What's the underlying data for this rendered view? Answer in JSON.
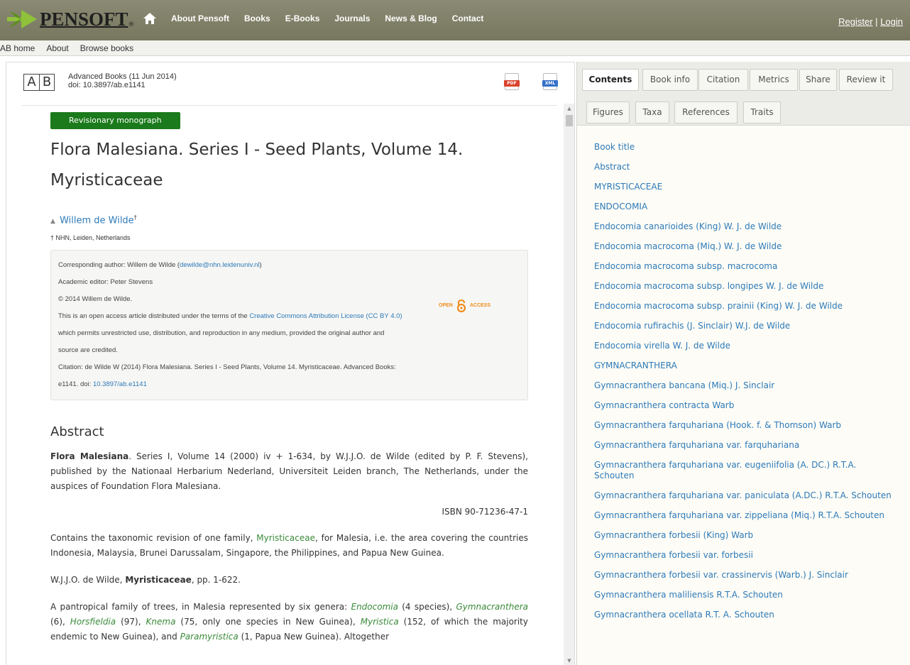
{
  "brand": {
    "name": "PENSOFT",
    "reg": "®"
  },
  "main_nav": [
    "About Pensoft",
    "Books",
    "E-Books",
    "Journals",
    "News & Blog",
    "Contact"
  ],
  "auth": {
    "register": "Register",
    "sep": "|",
    "login": "Login"
  },
  "sub_nav": [
    "AB home",
    "About",
    "Browse books"
  ],
  "doc": {
    "journal_line": "Advanced Books (11 Jun 2014)",
    "doi_line": "doi: 10.3897/ab.e1141",
    "ab_left": "A",
    "ab_right": "B",
    "pdf_label": "PDF",
    "xml_label": "XML",
    "badge": "Revisionary monograph",
    "title": "Flora Malesiana. Series I - Seed Plants, Volume 14. Myristicaceae",
    "author": "Willem de Wilde",
    "author_sup": "†",
    "affiliation": "† NHN, Leiden, Netherlands"
  },
  "info": {
    "corr_prefix": "Corresponding author: Willem de Wilde (",
    "corr_email": "dewilde@nhn.leidenuniv.nl",
    "corr_suffix": ")",
    "editor": "Academic editor: Peter Stevens",
    "copyright": "© 2014 Willem de Wilde.",
    "license_prefix": "This is an open access article distributed under the terms of the ",
    "license_link": "Creative Commons Attribution License (CC BY 4.0)",
    "license_line2": "which permits unrestricted use, distribution, and reproduction in any medium, provided the original author and",
    "license_line3": "source are credited.",
    "citation_line1": "Citation: de Wilde W (2014) Flora Malesiana. Series I - Seed Plants, Volume 14. Myristicaceae. Advanced Books:",
    "citation_prefix": "e1141. doi: ",
    "citation_doi": "10.3897/ab.e1141",
    "oa_open": "OPEN",
    "oa_access": "ACCESS"
  },
  "abstract": {
    "heading": "Abstract",
    "p1_bold": "Flora Malesiana",
    "p1_rest": ". Series I, Volume 14 (2000) iv + 1-634, by W.J.J.O. de Wilde (edited by P. F. Stevens), published by the Nationaal Herbarium Nederland, Universiteit Leiden branch, The Netherlands, under the auspices of Foundation Flora Malesiana.",
    "isbn": "ISBN 90-71236-47-1",
    "p2_a": "Contains the taxonomic revision of one family, ",
    "p2_link": "Myristicaceae",
    "p2_b": ", for Malesia, i.e. the area covering the countries Indonesia, Malaysia, Brunei Darussalam, Singapore, the Philippines, and Papua New Guinea.",
    "p3_a": "W.J.J.O. de Wilde, ",
    "p3_bold": "Myristicaceae",
    "p3_b": ", pp. 1-622.",
    "p4_a": "A pantropical family of trees, in Malesia represented by six genera: ",
    "p4_g1": "Endocomia",
    "p4_b": " (4 species), ",
    "p4_g2": "Gymnacranthera",
    "p4_c": " (6), ",
    "p4_g3": "Horsfieldia",
    "p4_d": " (97), ",
    "p4_g4": "Knema",
    "p4_e": " (75, only one species in New Guinea), ",
    "p4_g5": "Myristica",
    "p4_f": " (152, of which the majority endemic to New Guinea), and ",
    "p4_g6": "Paramyristica",
    "p4_g": " (1, Papua New Guinea). Altogether"
  },
  "tabs_row1": [
    "Contents",
    "Book info",
    "Citation",
    "Metrics",
    "Share",
    "Review it"
  ],
  "tabs_row2": [
    "Figures",
    "Taxa",
    "References",
    "Traits"
  ],
  "toc": [
    "Book title",
    "Abstract",
    "MYRISTICACEAE",
    "ENDOCOMIA",
    "Endocomia canarioides (King) W. J. de Wilde",
    "Endocomia macrocoma (Miq.) W. J. de Wilde",
    "Endocomia macrocoma subsp. macrocoma",
    "Endocomia macrocoma subsp. longipes W. J. de Wilde",
    "Endocomia macrocoma subsp. prainii (King) W. J. de Wilde",
    "Endocomia rufirachis (J. Sinclair) W.J. de Wilde",
    "Endocomia virella W. J. de Wilde",
    "GYMNACRANTHERA",
    "Gymnacranthera bancana (Miq.) J. Sinclair",
    "Gymnacranthera contracta Warb",
    "Gymnacranthera farquhariana (Hook. f. & Thomson) Warb",
    "Gymnacranthera farquhariana var. farquhariana",
    "Gymnacranthera farquhariana var. eugeniifolia (A. DC.) R.T.A. Schouten",
    "Gymnacranthera farquhariana var. paniculata (A.DC.) R.T.A. Schouten",
    "Gymnacranthera farquhariana var. zippeliana (Miq.) R.T.A. Schouten",
    "Gymnacranthera forbesii (King) Warb",
    "Gymnacranthera forbesii var. forbesii",
    "Gymnacranthera forbesii var. crassinervis (Warb.) J. Sinclair",
    "Gymnacranthera maliliensis R.T.A. Schouten",
    "Gymnacranthera ocellata R.T. A. Schouten"
  ]
}
